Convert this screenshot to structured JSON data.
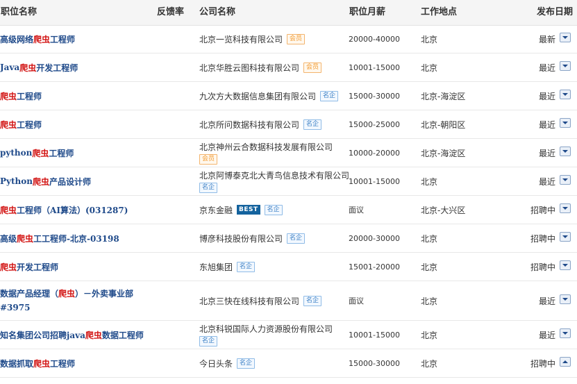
{
  "header": {
    "job_title": "职位名称",
    "feedback_rate": "反馈率",
    "company_name": "公司名称",
    "salary": "职位月薪",
    "location": "工作地点",
    "publish_date": "发布日期"
  },
  "rows": [
    {
      "job": {
        "before": "高级网络",
        "keyword": "爬虫",
        "after": "工程师"
      },
      "company": "北京一览科技有限公司",
      "badge": "会员",
      "badge_type": "member",
      "best": "",
      "salary": "20000-40000",
      "location": "北京",
      "date": "最新"
    },
    {
      "job": {
        "before": "Java",
        "keyword": "爬虫",
        "after": "开发工程师"
      },
      "company": "北京华胜云图科技有限公司",
      "badge": "会员",
      "badge_type": "member",
      "best": "",
      "salary": "10001-15000",
      "location": "北京",
      "date": "最近"
    },
    {
      "job": {
        "before": "",
        "keyword": "爬虫",
        "after": "工程师"
      },
      "company": "九次方大数据信息集团有限公司",
      "badge": "名企",
      "badge_type": "famous",
      "best": "",
      "salary": "15000-30000",
      "location": "北京-海淀区",
      "date": "最近"
    },
    {
      "job": {
        "before": "",
        "keyword": "爬虫",
        "after": "工程师"
      },
      "company": "北京所问数据科技有限公司",
      "badge": "名企",
      "badge_type": "famous",
      "best": "",
      "salary": "15000-25000",
      "location": "北京-朝阳区",
      "date": "最近"
    },
    {
      "job": {
        "before": "python",
        "keyword": "爬虫",
        "after": "工程师"
      },
      "company": "北京神州云合数据科技发展有限公司",
      "badge": "会员",
      "badge_type": "member",
      "best": "",
      "salary": "10000-20000",
      "location": "北京-海淀区",
      "date": "最近"
    },
    {
      "job": {
        "before": "Python",
        "keyword": "爬虫",
        "after": "产品设计师"
      },
      "company": "北京阿博泰克北大青鸟信息技术有限公司",
      "badge": "名企",
      "badge_type": "famous",
      "best": "",
      "salary": "10001-15000",
      "location": "北京",
      "date": "最近"
    },
    {
      "job": {
        "before": "",
        "keyword": "爬虫",
        "after": "工程师（AI算法）(031287)"
      },
      "company": "京东金融",
      "badge": "名企",
      "badge_type": "famous",
      "best": "BEST",
      "salary": "面议",
      "location": "北京-大兴区",
      "date": "招聘中"
    },
    {
      "job": {
        "before": "高级",
        "keyword": "爬虫",
        "after": "工工程师-北京-03198"
      },
      "company": "博彦科技股份有限公司",
      "badge": "名企",
      "badge_type": "famous",
      "best": "",
      "salary": "20000-30000",
      "location": "北京",
      "date": "招聘中"
    },
    {
      "job": {
        "before": "",
        "keyword": "爬虫",
        "after": "开发工程师"
      },
      "company": "东旭集团",
      "badge": "名企",
      "badge_type": "famous",
      "best": "",
      "salary": "15001-20000",
      "location": "北京",
      "date": "招聘中"
    },
    {
      "job": {
        "before": "数据产品经理（",
        "keyword": "爬虫",
        "after": "）－外卖事业部#3975"
      },
      "company": "北京三快在线科技有限公司",
      "badge": "名企",
      "badge_type": "famous",
      "best": "",
      "salary": "面议",
      "location": "北京",
      "date": "最近"
    },
    {
      "job": {
        "before": "知名集团公司招聘java",
        "keyword": "爬虫",
        "after": "数据工程师"
      },
      "company": "北京科锐国际人力资源股份有限公司",
      "badge": "名企",
      "badge_type": "famous",
      "best": "",
      "salary": "10001-15000",
      "location": "北京",
      "date": "最近"
    },
    {
      "job": {
        "before": "数据抓取",
        "keyword": "爬虫",
        "after": "工程师"
      },
      "company": "今日头条",
      "badge": "名企",
      "badge_type": "famous",
      "best": "",
      "salary": "15000-30000",
      "location": "北京",
      "date": "招聘中"
    }
  ]
}
